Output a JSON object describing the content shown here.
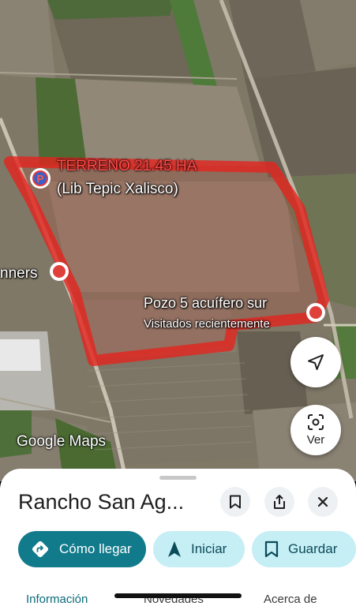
{
  "map": {
    "labels": {
      "terreno_line1": "TERRENO 21.45 HA",
      "terreno_line2": "(Lib Tepic Xalisco)",
      "runners": "nners",
      "pozo": "Pozo 5 acuífero sur",
      "visitados": "Visitados recientemente"
    },
    "parking_glyph": "P",
    "logo": "Google Maps",
    "buttons": {
      "navigation_icon": "navigation-arrow-icon",
      "lens_label": "Ver"
    },
    "colors": {
      "boundary": "#e3241e"
    }
  },
  "sheet": {
    "title": "Rancho San Ag...",
    "icons": [
      "bookmark-icon",
      "share-icon",
      "close-icon"
    ],
    "actions": [
      {
        "label": "Cómo llegar",
        "icon": "directions-icon"
      },
      {
        "label": "Iniciar",
        "icon": "navigation-icon"
      },
      {
        "label": "Guardar",
        "icon": "bookmark-icon"
      }
    ],
    "tabs": [
      "Información",
      "Novedades",
      "Acerca de"
    ]
  },
  "colors": {
    "primary": "#117a8b",
    "chip": "#c6eef5"
  }
}
